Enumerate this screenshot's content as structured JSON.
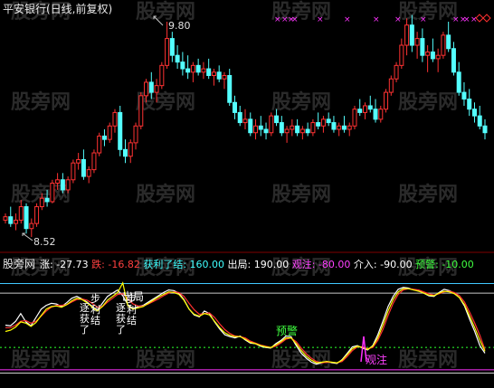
{
  "header": {
    "title": "平安银行(日线,前复权)"
  },
  "watermark": "股旁网",
  "colors": {
    "background": "#000000",
    "up": "#ff3232",
    "down": "#54ffff",
    "watch_marker": "#ff33ff",
    "line_white": "#ffffff",
    "line_yellow": "#ffff00",
    "line_red": "#ff3030",
    "guide_cyan": "#40c8ff",
    "guide_green": "#20c020",
    "guide_magenta": "#ff30ff",
    "label_red": "#ff4040",
    "label_cyan": "#40ffff",
    "label_white": "#ffffff",
    "label_magenta": "#ff40ff",
    "label_green": "#40ff40",
    "diamond": "#ff3030"
  },
  "price_panel": {
    "high_label": "9.80",
    "low_label": "8.52"
  },
  "indicator_bar": {
    "name": "股旁网",
    "items": [
      {
        "key": "涨:",
        "value": "-27.73",
        "color": "label_white"
      },
      {
        "key": "跌:",
        "value": "-16.82",
        "color": "label_red"
      },
      {
        "key": "获利了结:",
        "value": "160.00",
        "color": "label_cyan"
      },
      {
        "key": "出局:",
        "value": "190.00",
        "color": "label_white"
      },
      {
        "key": "观注:",
        "value": "-80.00",
        "color": "label_magenta"
      },
      {
        "key": "介入:",
        "value": "-90.00",
        "color": "label_white"
      },
      {
        "key": "预警:",
        "value": "-10.00",
        "color": "label_green"
      }
    ]
  },
  "annotations": {
    "profit_take": "逐步获利了结",
    "exit": "出局",
    "warning": "预警",
    "watch": "观注"
  },
  "chart_data": [
    {
      "type": "candlestick",
      "title": "平安银行(日线,前复权)",
      "y_markers": {
        "high": 9.8,
        "low": 8.52
      },
      "candles": [
        [
          8.62,
          8.66,
          8.6,
          8.64
        ],
        [
          8.64,
          8.7,
          8.58,
          8.6
        ],
        [
          8.6,
          8.66,
          8.56,
          8.62
        ],
        [
          8.62,
          8.74,
          8.6,
          8.7
        ],
        [
          8.7,
          8.72,
          8.54,
          8.57
        ],
        [
          8.57,
          8.63,
          8.52,
          8.6
        ],
        [
          8.6,
          8.72,
          8.58,
          8.7
        ],
        [
          8.7,
          8.78,
          8.68,
          8.75
        ],
        [
          8.75,
          8.8,
          8.7,
          8.73
        ],
        [
          8.73,
          8.86,
          8.72,
          8.84
        ],
        [
          8.84,
          8.9,
          8.8,
          8.86
        ],
        [
          8.86,
          8.9,
          8.78,
          8.8
        ],
        [
          8.8,
          8.88,
          8.78,
          8.86
        ],
        [
          8.86,
          8.98,
          8.84,
          8.96
        ],
        [
          8.96,
          9.02,
          8.92,
          8.98
        ],
        [
          8.98,
          9.04,
          8.86,
          8.88
        ],
        [
          8.88,
          8.94,
          8.84,
          8.92
        ],
        [
          8.92,
          9.04,
          8.9,
          9.02
        ],
        [
          9.02,
          9.14,
          9.0,
          9.12
        ],
        [
          9.12,
          9.16,
          9.06,
          9.1
        ],
        [
          9.1,
          9.2,
          9.08,
          9.18
        ],
        [
          9.18,
          9.28,
          9.14,
          9.26
        ],
        [
          9.26,
          9.3,
          9.0,
          9.04
        ],
        [
          9.04,
          9.1,
          8.96,
          9.0
        ],
        [
          9.0,
          9.1,
          8.96,
          9.08
        ],
        [
          9.08,
          9.2,
          9.04,
          9.18
        ],
        [
          9.18,
          9.38,
          9.16,
          9.36
        ],
        [
          9.36,
          9.46,
          9.32,
          9.44
        ],
        [
          9.44,
          9.5,
          9.34,
          9.38
        ],
        [
          9.38,
          9.46,
          9.32,
          9.42
        ],
        [
          9.42,
          9.56,
          9.4,
          9.54
        ],
        [
          9.54,
          9.8,
          9.52,
          9.7
        ],
        [
          9.7,
          9.74,
          9.56,
          9.6
        ],
        [
          9.6,
          9.66,
          9.52,
          9.56
        ],
        [
          9.56,
          9.62,
          9.48,
          9.52
        ],
        [
          9.52,
          9.6,
          9.46,
          9.5
        ],
        [
          9.5,
          9.56,
          9.44,
          9.54
        ],
        [
          9.54,
          9.58,
          9.48,
          9.5
        ],
        [
          9.5,
          9.56,
          9.46,
          9.52
        ],
        [
          9.52,
          9.58,
          9.46,
          9.48
        ],
        [
          9.48,
          9.52,
          9.42,
          9.5
        ],
        [
          9.5,
          9.54,
          9.44,
          9.46
        ],
        [
          9.46,
          9.5,
          9.4,
          9.48
        ],
        [
          9.48,
          9.52,
          9.3,
          9.32
        ],
        [
          9.32,
          9.36,
          9.22,
          9.26
        ],
        [
          9.26,
          9.3,
          9.18,
          9.2
        ],
        [
          9.2,
          9.28,
          9.16,
          9.22
        ],
        [
          9.22,
          9.26,
          9.12,
          9.14
        ],
        [
          9.14,
          9.22,
          9.1,
          9.18
        ],
        [
          9.18,
          9.24,
          9.12,
          9.16
        ],
        [
          9.16,
          9.2,
          9.1,
          9.14
        ],
        [
          9.14,
          9.26,
          9.12,
          9.24
        ],
        [
          9.24,
          9.28,
          9.18,
          9.2
        ],
        [
          9.2,
          9.24,
          9.12,
          9.14
        ],
        [
          9.14,
          9.18,
          9.08,
          9.16
        ],
        [
          9.16,
          9.22,
          9.12,
          9.18
        ],
        [
          9.18,
          9.22,
          9.12,
          9.14
        ],
        [
          9.14,
          9.18,
          9.1,
          9.16
        ],
        [
          9.16,
          9.2,
          9.12,
          9.14
        ],
        [
          9.14,
          9.22,
          9.12,
          9.2
        ],
        [
          9.2,
          9.26,
          9.16,
          9.18
        ],
        [
          9.18,
          9.24,
          9.14,
          9.22
        ],
        [
          9.22,
          9.26,
          9.18,
          9.2
        ],
        [
          9.2,
          9.24,
          9.14,
          9.16
        ],
        [
          9.16,
          9.2,
          9.12,
          9.18
        ],
        [
          9.18,
          9.24,
          9.14,
          9.16
        ],
        [
          9.16,
          9.2,
          9.12,
          9.18
        ],
        [
          9.18,
          9.3,
          9.16,
          9.28
        ],
        [
          9.28,
          9.34,
          9.24,
          9.26
        ],
        [
          9.26,
          9.32,
          9.22,
          9.3
        ],
        [
          9.3,
          9.36,
          9.26,
          9.28
        ],
        [
          9.28,
          9.34,
          9.2,
          9.22
        ],
        [
          9.22,
          9.3,
          9.2,
          9.28
        ],
        [
          9.28,
          9.4,
          9.26,
          9.38
        ],
        [
          9.38,
          9.48,
          9.36,
          9.46
        ],
        [
          9.46,
          9.56,
          9.44,
          9.54
        ],
        [
          9.54,
          9.7,
          9.52,
          9.66
        ],
        [
          9.66,
          9.82,
          9.6,
          9.78
        ],
        [
          9.78,
          9.84,
          9.62,
          9.66
        ],
        [
          9.66,
          9.74,
          9.58,
          9.7
        ],
        [
          9.7,
          9.76,
          9.56,
          9.6
        ],
        [
          9.6,
          9.66,
          9.5,
          9.62
        ],
        [
          9.62,
          9.7,
          9.56,
          9.58
        ],
        [
          9.58,
          9.64,
          9.5,
          9.6
        ],
        [
          9.6,
          9.74,
          9.58,
          9.72
        ],
        [
          9.72,
          9.8,
          9.62,
          9.64
        ],
        [
          9.64,
          9.68,
          9.48,
          9.5
        ],
        [
          9.5,
          9.56,
          9.36,
          9.38
        ],
        [
          9.38,
          9.44,
          9.3,
          9.34
        ],
        [
          9.34,
          9.4,
          9.24,
          9.28
        ],
        [
          9.28,
          9.32,
          9.2,
          9.24
        ],
        [
          9.24,
          9.3,
          9.16,
          9.18
        ],
        [
          9.18,
          9.22,
          9.1,
          9.14
        ]
      ]
    },
    {
      "type": "line",
      "y_levels": {
        "exit": 190,
        "profit_take": 160,
        "warning": -10,
        "watch": -80,
        "enter": -90
      },
      "ylim": [
        -100,
        200
      ],
      "series": [
        {
          "name": "涨",
          "color": "line_white",
          "values": [
            60,
            58,
            72,
            96,
            70,
            58,
            84,
            110,
            122,
            128,
            126,
            118,
            130,
            144,
            150,
            142,
            132,
            118,
            106,
            128,
            150,
            160,
            170,
            152,
            124,
            112,
            118,
            122,
            132,
            142,
            152,
            162,
            170,
            168,
            160,
            140,
            110,
            92,
            86,
            104,
            96,
            70,
            48,
            30,
            24,
            20,
            26,
            14,
            4,
            2,
            -6,
            -10,
            -12,
            2,
            12,
            26,
            24,
            -4,
            -28,
            -44,
            -56,
            -62,
            -58,
            -54,
            -58,
            -60,
            -48,
            -28,
            -8,
            -4,
            -12,
            -18,
            -4,
            30,
            72,
            118,
            150,
            172,
            178,
            176,
            170,
            168,
            160,
            152,
            150,
            162,
            172,
            168,
            160,
            146,
            120,
            78,
            40,
            -4,
            -27.73
          ]
        },
        {
          "name": "跌",
          "color": "line_red",
          "values": [
            52,
            52,
            60,
            72,
            74,
            66,
            72,
            88,
            104,
            116,
            122,
            122,
            124,
            132,
            140,
            142,
            138,
            128,
            116,
            118,
            132,
            144,
            156,
            158,
            142,
            126,
            120,
            120,
            126,
            134,
            142,
            152,
            160,
            164,
            162,
            150,
            128,
            108,
            94,
            96,
            98,
            84,
            64,
            46,
            34,
            26,
            24,
            20,
            10,
            4,
            -2,
            -6,
            -10,
            -6,
            4,
            16,
            20,
            8,
            -12,
            -30,
            -44,
            -54,
            -58,
            -56,
            -56,
            -58,
            -54,
            -38,
            -20,
            -8,
            -8,
            -14,
            -10,
            12,
            46,
            90,
            128,
            156,
            170,
            174,
            172,
            170,
            164,
            158,
            154,
            158,
            164,
            166,
            162,
            152,
            132,
            100,
            66,
            28,
            -16.82
          ]
        },
        {
          "name": "预警",
          "color": "line_yellow",
          "values": [
            40,
            44,
            54,
            70,
            66,
            56,
            68,
            90,
            110,
            118,
            120,
            116,
            124,
            136,
            144,
            140,
            130,
            116,
            104,
            118,
            138,
            150,
            162,
            192,
            120,
            110,
            114,
            118,
            128,
            138,
            148,
            156,
            164,
            162,
            156,
            138,
            110,
            94,
            88,
            96,
            92,
            72,
            52,
            36,
            28,
            24,
            24,
            16,
            6,
            2,
            -4,
            -8,
            -10,
            -2,
            8,
            20,
            20,
            2,
            -20,
            -38,
            -50,
            -58,
            -56,
            -54,
            -56,
            -58,
            -50,
            -32,
            -14,
            -6,
            -10,
            -16,
            -6,
            20,
            60,
            104,
            140,
            164,
            174,
            174,
            170,
            166,
            160,
            154,
            152,
            160,
            166,
            164,
            158,
            146,
            124,
            88,
            52,
            12,
            -22
          ]
        }
      ]
    }
  ]
}
